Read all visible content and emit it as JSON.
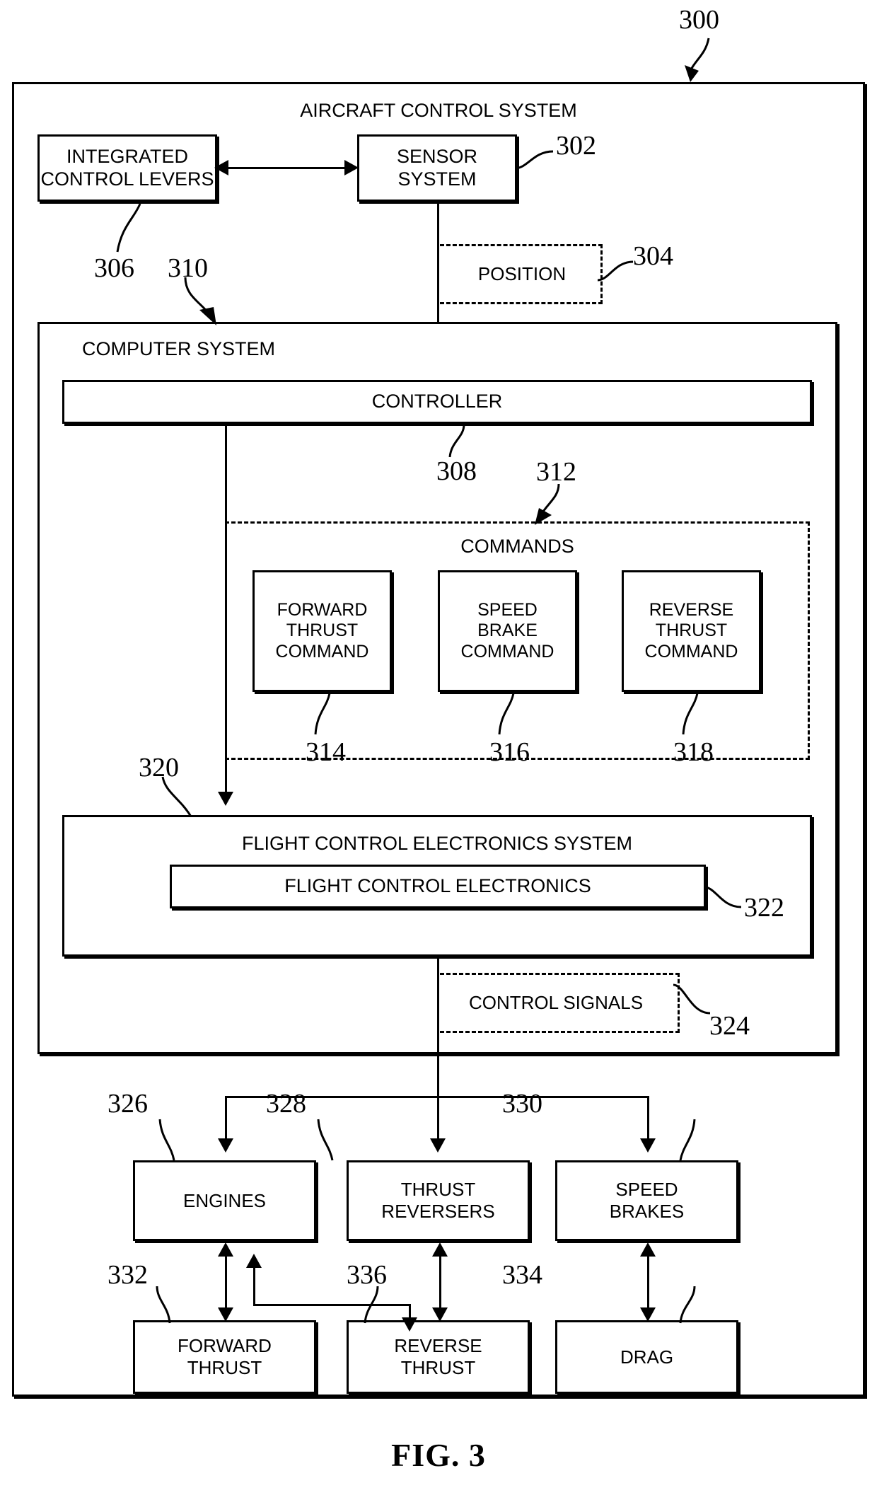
{
  "figure": {
    "caption": "FIG. 3",
    "figure_ref": "300"
  },
  "outer": {
    "title": "AIRCRAFT CONTROL SYSTEM",
    "ref": "300"
  },
  "blocks": {
    "integrated_control_levers": {
      "label": "INTEGRATED\nCONTROL LEVERS",
      "ref": "306"
    },
    "sensor_system": {
      "label": "SENSOR\nSYSTEM",
      "ref": "302"
    },
    "position": {
      "label": "POSITION",
      "ref": "304"
    },
    "computer_system": {
      "label": "COMPUTER SYSTEM",
      "ref": "310"
    },
    "controller": {
      "label": "CONTROLLER",
      "ref": "308"
    },
    "commands": {
      "label": "COMMANDS",
      "ref": "312"
    },
    "forward_thrust_command": {
      "label": "FORWARD\nTHRUST\nCOMMAND",
      "ref": "314"
    },
    "speed_brake_command": {
      "label": "SPEED\nBRAKE\nCOMMAND",
      "ref": "316"
    },
    "reverse_thrust_command": {
      "label": "REVERSE\nTHRUST\nCOMMAND",
      "ref": "318"
    },
    "flight_control_electronics_system": {
      "label": "FLIGHT CONTROL ELECTRONICS SYSTEM",
      "ref": "320"
    },
    "flight_control_electronics": {
      "label": "FLIGHT CONTROL ELECTRONICS",
      "ref": "322"
    },
    "control_signals": {
      "label": "CONTROL SIGNALS",
      "ref": "324"
    },
    "engines": {
      "label": "ENGINES",
      "ref": "326"
    },
    "thrust_reversers": {
      "label": "THRUST\nREVERSERS",
      "ref": "328"
    },
    "speed_brakes": {
      "label": "SPEED\nBRAKES",
      "ref": "330"
    },
    "forward_thrust": {
      "label": "FORWARD\nTHRUST",
      "ref": "332"
    },
    "reverse_thrust": {
      "label": "REVERSE\nTHRUST",
      "ref": "336"
    },
    "drag": {
      "label": "DRAG",
      "ref": "334"
    }
  },
  "refs": {
    "r300": "300",
    "r302": "302",
    "r304": "304",
    "r306": "306",
    "r308": "308",
    "r310": "310",
    "r312": "312",
    "r314": "314",
    "r316": "316",
    "r318": "318",
    "r320": "320",
    "r322": "322",
    "r324": "324",
    "r326": "326",
    "r328": "328",
    "r330": "330",
    "r332": "332",
    "r334": "334",
    "r336": "336"
  },
  "style": {
    "line_color": "#000000",
    "background": "#ffffff"
  }
}
